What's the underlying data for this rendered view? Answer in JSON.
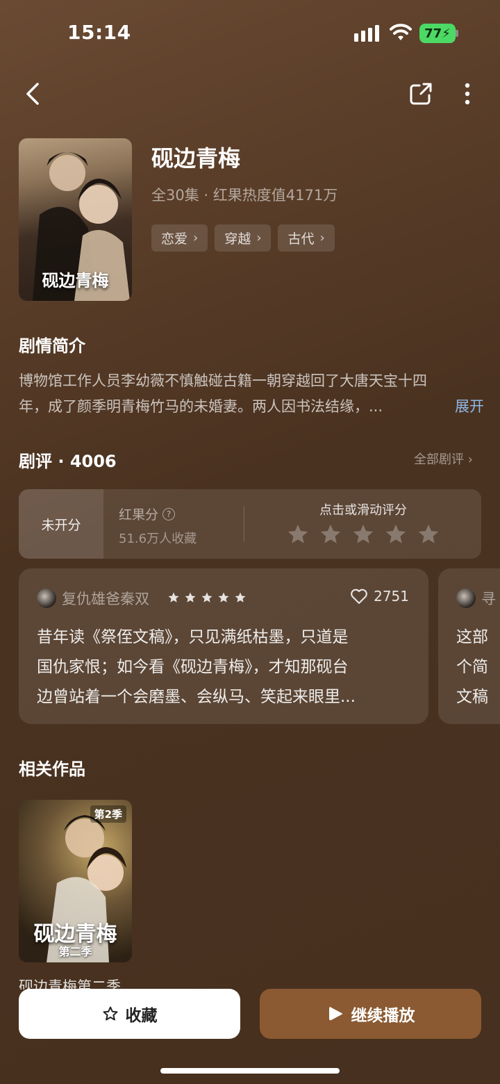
{
  "status": {
    "time": "15:14",
    "battery": "77"
  },
  "drama": {
    "title": "砚边青梅",
    "poster_title": "砚边青梅",
    "meta": "全30集 · 红果热度值4171万",
    "tags": [
      "恋爱",
      "穿越",
      "古代"
    ]
  },
  "synopsis": {
    "title": "剧情简介",
    "line1": "博物馆工作人员李幼薇不慎触碰古籍一朝穿越回了大唐天宝十四",
    "line2": "年，成了颜季明青梅竹马的未婚妻。两人因书法结缘，...",
    "expand": "展开"
  },
  "reviews": {
    "title": "剧评 · 4006",
    "all_link": "全部剧评 ›",
    "rating": {
      "status": "未开分",
      "label": "红果分",
      "favorites": "51.6万人收藏",
      "cta": "点击或滑动评分"
    },
    "items": [
      {
        "user": "复仇雄爸秦双",
        "stars": 5,
        "likes": "2751",
        "lines": [
          "昔年读《祭侄文稿》，只见满纸枯墨，只道是",
          "国仇家恨；如今看《砚边青梅》，才知那砚台",
          "边曾站着一个会磨墨、会纵马、笑起来眼里..."
        ]
      },
      {
        "user": "寻",
        "lines": [
          "这部",
          "个简",
          "文稿"
        ]
      }
    ]
  },
  "related": {
    "title": "相关作品",
    "season_badge": "第2季",
    "poster_title": "砚边青梅",
    "poster_sub": "第二季",
    "name": "砚边青梅第二季"
  },
  "actions": {
    "favorite": "收藏",
    "play": "继续播放"
  },
  "colors": {
    "play_button": "#8b5a32",
    "expand_link": "#8fb8e8",
    "battery": "#4cd964"
  }
}
